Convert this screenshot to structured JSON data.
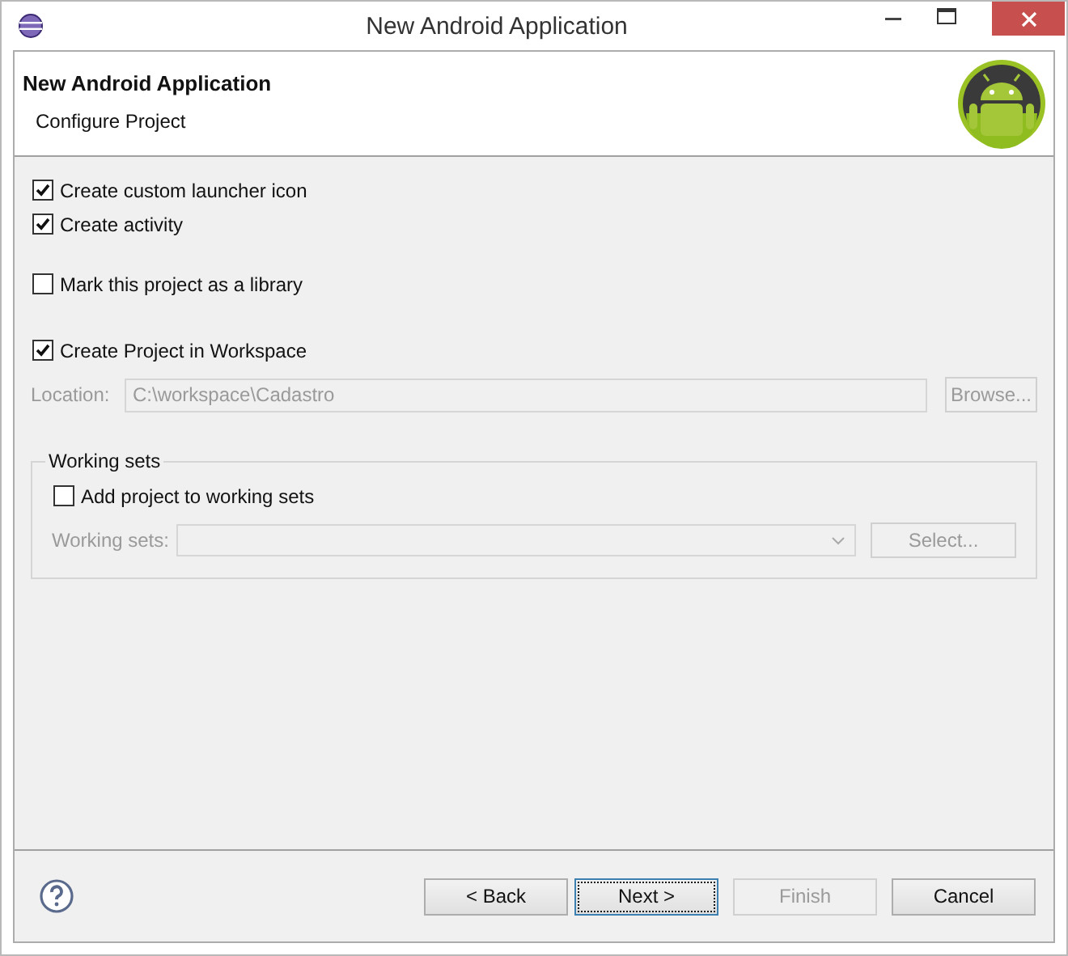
{
  "window": {
    "title": "New Android Application"
  },
  "header": {
    "title": "New Android Application",
    "subtitle": "Configure Project"
  },
  "options": [
    {
      "label": "Create custom launcher icon",
      "checked": true
    },
    {
      "label": "Create activity",
      "checked": true
    },
    {
      "label": "Mark this project as a library",
      "checked": false
    },
    {
      "label": "Create Project in Workspace",
      "checked": true
    }
  ],
  "location": {
    "label": "Location:",
    "value": "C:\\workspace\\Cadastro",
    "disabled": true,
    "button": "Browse..."
  },
  "working_sets": {
    "title": "Working sets",
    "add": {
      "label": "Add project to working sets",
      "checked": false
    },
    "label": "Working sets:",
    "disabled": true,
    "button": "Select..."
  },
  "buttons": [
    {
      "label": "< Back",
      "disabled": false,
      "default": false
    },
    {
      "label": "Next >",
      "disabled": false,
      "default": true
    },
    {
      "label": "Finish",
      "disabled": true,
      "default": false
    },
    {
      "label": "Cancel",
      "disabled": false,
      "default": false
    }
  ]
}
